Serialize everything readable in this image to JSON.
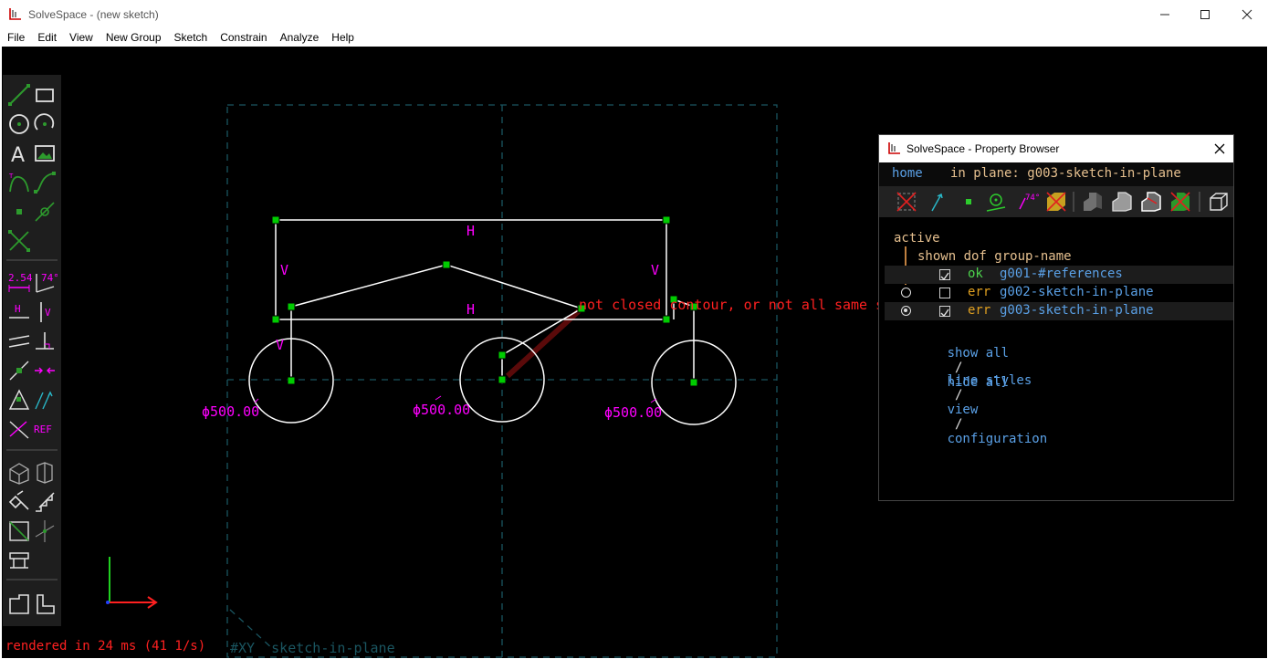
{
  "window": {
    "title": "SolveSpace - (new sketch)"
  },
  "menu": [
    "File",
    "Edit",
    "View",
    "New Group",
    "Sketch",
    "Constrain",
    "Analyze",
    "Help"
  ],
  "toolbar": {
    "dim_label": "2.54",
    "angle_label": "74°",
    "h_label": "H",
    "v_label": "V",
    "ref_label": "REF"
  },
  "sketch": {
    "error_message": "not closed contour, or not all same style!",
    "constraint_h_top": "H",
    "constraint_h_mid": "H",
    "constraint_v_left": "V",
    "constraint_v_right": "V",
    "constraint_v_lower": "V",
    "diameter_left": "ϕ500.00",
    "diameter_mid": "ϕ500.00",
    "diameter_right": "ϕ500.00",
    "colors": {
      "lines": "#ffffff",
      "points": "#00cc00",
      "constraints": "#ff00ff",
      "error": "#ff2020",
      "workplane": "#1a5560"
    }
  },
  "status": {
    "render": "rendered in 24 ms (41 1/s)",
    "workplane": "#XY  sketch-in-plane"
  },
  "property_browser": {
    "title": "SolveSpace - Property Browser",
    "nav_home": "home",
    "nav_plane": "in plane: g003-sketch-in-plane",
    "icons": [
      "show-workplanes-icon",
      "show-normals-icon",
      "show-points-icon",
      "show-construction-icon",
      "show-constraints-icon",
      "show-faces-icon",
      "show-shaded-icon",
      "show-edges-icon",
      "show-outline-icon",
      "show-mesh-icon",
      "show-hidden-lines-icon",
      "perspective-icon"
    ],
    "active_label": "active",
    "header": "shown dof group-name",
    "groups": [
      {
        "status": "ok",
        "name": "g001-#references",
        "shown": true,
        "active": false,
        "radio": false
      },
      {
        "status": "err",
        "name": "g002-sketch-in-plane",
        "shown": false,
        "active": false,
        "radio": true
      },
      {
        "status": "err",
        "name": "g003-sketch-in-plane",
        "shown": true,
        "active": true,
        "radio": true
      }
    ],
    "show_all": "show all",
    "slash1": "/",
    "hide_all": "hide all",
    "line_styles": "line styles",
    "slash2": "/",
    "view": "view",
    "slash3": "/",
    "configuration": "configuration"
  }
}
